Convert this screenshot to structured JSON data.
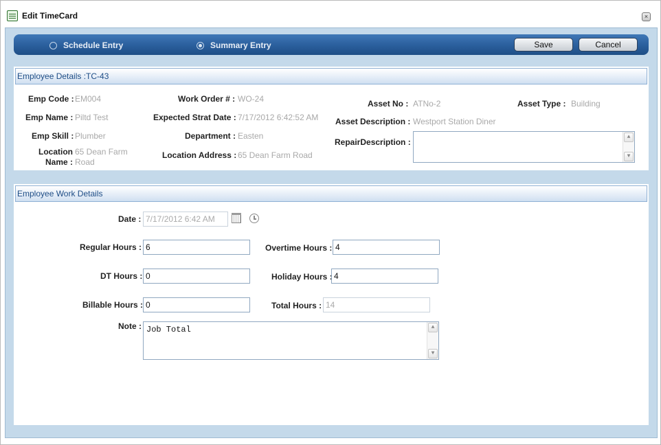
{
  "window": {
    "title": "Edit TimeCard",
    "close_glyph": "×"
  },
  "toolbar": {
    "radio_schedule": "Schedule Entry",
    "radio_summary": "Summary Entry",
    "selected": "Summary Entry",
    "save_label": "Save",
    "cancel_label": "Cancel"
  },
  "employee_details": {
    "header": "Employee Details :TC-43",
    "emp_code_label": "Emp Code :",
    "emp_code": "EM004",
    "emp_name_label": "Emp Name :",
    "emp_name": "Piltd Test",
    "emp_skill_label": "Emp Skill :",
    "emp_skill": "Plumber",
    "location_name_label": "Location Name :",
    "location_name": "65 Dean Farm Road",
    "work_order_label": "Work Order # :",
    "work_order": "WO-24",
    "expected_start_label": "Expected Strat Date :",
    "expected_start": "7/17/2012 6:42:52 AM",
    "department_label": "Department :",
    "department": "Easten",
    "location_address_label": "Location Address :",
    "location_address": "65 Dean Farm Road",
    "asset_no_label": "Asset No :",
    "asset_no": "ATNo-2",
    "asset_type_label": "Asset Type :",
    "asset_type": "Building",
    "asset_description_label": "Asset Description :",
    "asset_description": "Westport Station Diner",
    "repair_description_label": "RepairDescription :",
    "repair_description": ""
  },
  "work_details": {
    "header": "Employee Work Details",
    "date_label": "Date :",
    "date": "7/17/2012 6:42 AM",
    "regular_hours_label": "Regular Hours :",
    "regular_hours": "6",
    "overtime_hours_label": "Overtime Hours :",
    "overtime_hours": "4",
    "dt_hours_label": "DT Hours :",
    "dt_hours": "0",
    "holiday_hours_label": "Holiday Hours :",
    "holiday_hours": "4",
    "billable_hours_label": "Billable Hours :",
    "billable_hours": "0",
    "total_hours_label": "Total Hours :",
    "total_hours": "14",
    "note_label": "Note :",
    "note": "Job Total"
  },
  "icons": {
    "title": "timecard-icon",
    "close": "close-icon",
    "calendar": "calendar-icon",
    "clock": "clock-icon",
    "scroll_up": "scroll-up-arrow-icon",
    "scroll_down": "scroll-down-arrow-icon"
  },
  "glyphs": {
    "up": "▲",
    "down": "▼"
  }
}
